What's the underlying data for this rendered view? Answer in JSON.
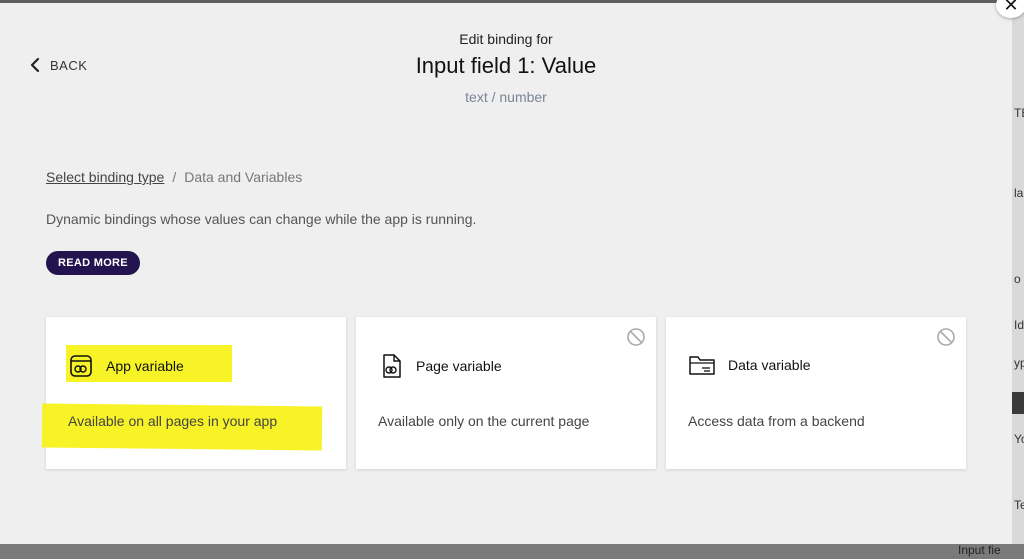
{
  "modal": {
    "close_glyph": "✕",
    "back_label": "BACK",
    "kicker": "Edit binding for",
    "title": "Input field 1: Value",
    "type_hint": "text / number",
    "breadcrumb": {
      "link": "Select binding type",
      "separator": "/",
      "current": "Data and Variables"
    },
    "description": "Dynamic bindings whose values can change while the app is running.",
    "read_more_label": "READ MORE",
    "cards": [
      {
        "title": "App variable",
        "subtitle": "Available on all pages in your app",
        "icon": "app-variable-icon",
        "disabled": false
      },
      {
        "title": "Page variable",
        "subtitle": "Available only on the current page",
        "icon": "page-variable-icon",
        "disabled": true
      },
      {
        "title": "Data variable",
        "subtitle": "Access data from a backend",
        "icon": "data-variable-icon",
        "disabled": true
      }
    ],
    "highlight_color": "#f7f21a",
    "accent_color": "#23144f"
  },
  "background": {
    "fragments": [
      "TE",
      "la",
      "o",
      "Id",
      "yp",
      "Yo",
      "Te"
    ],
    "bottom_fragment": "Input fie"
  }
}
